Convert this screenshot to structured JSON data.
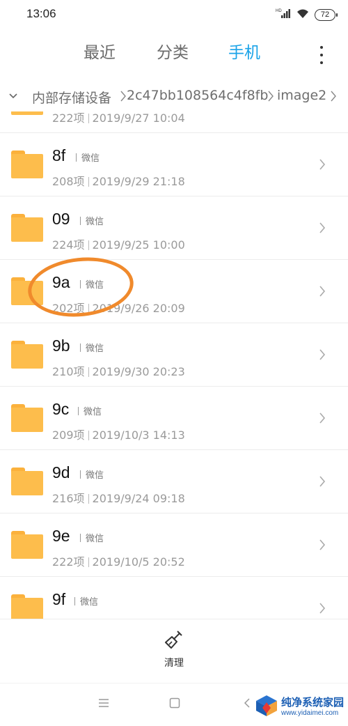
{
  "status_bar": {
    "time": "13:06",
    "network_label": "HD",
    "battery": "72"
  },
  "tabs": [
    {
      "label": "最近",
      "active": false
    },
    {
      "label": "分类",
      "active": false
    },
    {
      "label": "手机",
      "active": true
    }
  ],
  "breadcrumb": {
    "items": [
      "内部存储设备",
      "2c47bb108564c4f8fb",
      "image2"
    ]
  },
  "folders": [
    {
      "name": "",
      "tag": "",
      "count": "222项",
      "date": "2019/9/27 10:04",
      "partial": true
    },
    {
      "name": "8f",
      "tag": "微信",
      "count": "208项",
      "date": "2019/9/29 21:18"
    },
    {
      "name": "09",
      "tag": "微信",
      "count": "224项",
      "date": "2019/9/25 10:00"
    },
    {
      "name": "9a",
      "tag": "微信",
      "count": "202项",
      "date": "2019/9/26 20:09"
    },
    {
      "name": "9b",
      "tag": "微信",
      "count": "210项",
      "date": "2019/9/30 20:23"
    },
    {
      "name": "9c",
      "tag": "微信",
      "count": "209项",
      "date": "2019/10/3 14:13"
    },
    {
      "name": "9d",
      "tag": "微信",
      "count": "216项",
      "date": "2019/9/24 09:18"
    },
    {
      "name": "9e",
      "tag": "微信",
      "count": "222项",
      "date": "2019/10/5 20:52"
    },
    {
      "name": "9f",
      "tag": "微信",
      "count": "",
      "date": ""
    }
  ],
  "bottom_action": {
    "clean_label": "清理",
    "clean_icon": "broom-icon"
  },
  "nav_bar": {
    "menu_icon": "menu-icon",
    "home_icon": "home-icon",
    "back_icon": "back-icon"
  },
  "watermark": {
    "title": "纯净系统家园",
    "url": "www.yidaimei.com"
  },
  "colors": {
    "accent": "#1aa3e8",
    "folder": "#fdbd4c",
    "annotation": "#f08a2c"
  }
}
